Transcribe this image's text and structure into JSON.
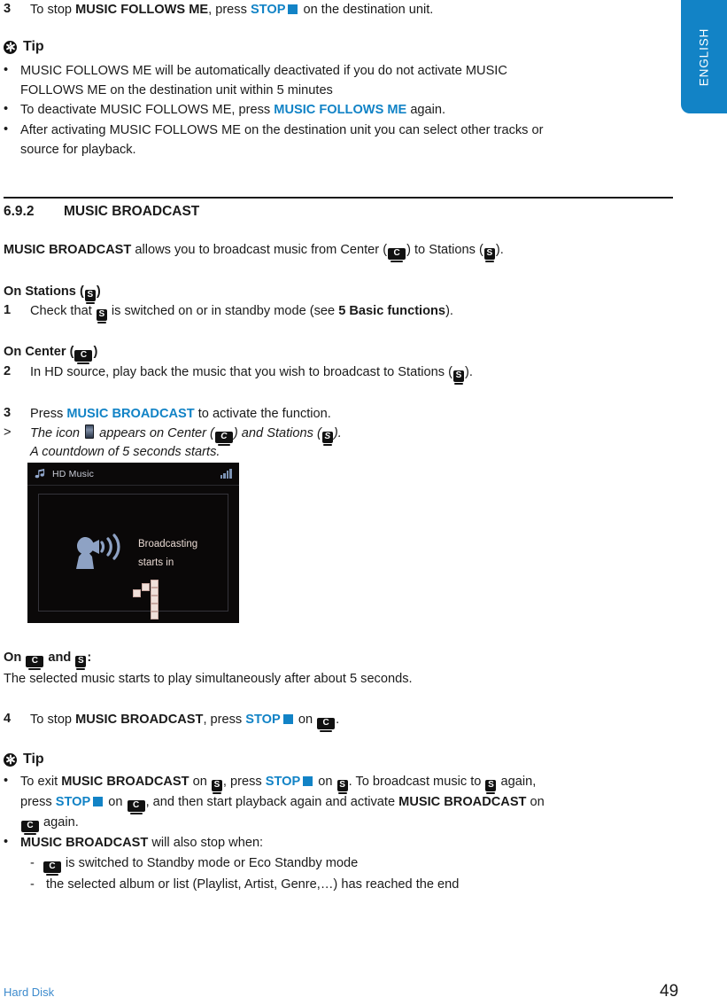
{
  "language_tab": {
    "label": "ENGLISH"
  },
  "footer": {
    "left": "Hard Disk",
    "page_number": "49"
  },
  "icons": {
    "center_letter": "C",
    "station_letter": "S",
    "tip_label": "Tip"
  },
  "step3": {
    "number": "3",
    "pre": "To stop ",
    "bold1": "MUSIC FOLLOWS ME",
    "mid": ", press ",
    "blue": "STOP",
    "post": " on the destination unit."
  },
  "tip1": {
    "label": "Tip",
    "bullets": [
      {
        "line1": "MUSIC FOLLOWS ME will be automatically deactivated if you do not activate MUSIC",
        "line2": "FOLLOWS ME on the destination unit within 5 minutes"
      },
      {
        "pre": "To deactivate MUSIC FOLLOWS ME, press ",
        "blue": "MUSIC FOLLOWS ME",
        "post": " again."
      },
      {
        "line1": "After activating MUSIC FOLLOWS ME on the destination unit you can select other tracks or",
        "line2": "source for playback."
      }
    ]
  },
  "section": {
    "number": "6.9.2",
    "title": "MUSIC BROADCAST"
  },
  "intro": {
    "bold": "MUSIC BROADCAST",
    "part1": " allows you to broadcast music from Center (",
    "part2": ") to Stations (",
    "part3": ")."
  },
  "on_stations": {
    "heading_pre": "On Stations (",
    "heading_post": ")",
    "step_number": "1",
    "text_pre": "Check that ",
    "text_mid": " is switched on or in standby mode (see ",
    "text_bold": "5 Basic functions",
    "text_post": ")."
  },
  "on_center": {
    "heading_pre": "On Center (",
    "heading_post": ")",
    "step2_number": "2",
    "step2_pre": "In HD source, play back the music that you wish to broadcast to Stations (",
    "step2_post": ").",
    "step3_number": "3",
    "step3_pre": "Press ",
    "step3_blue": "MUSIC BROADCAST",
    "step3_post": " to activate the function.",
    "result_marker": ">",
    "result_pre": "The icon ",
    "result_mid": " appears on Center (",
    "result_mid2": ") and Stations (",
    "result_post": ").",
    "result_line2": "A countdown of 5 seconds starts."
  },
  "device_screenshot": {
    "source_title": "HD Music",
    "message_line1": "Broadcasting",
    "message_line2": "starts in",
    "countdown_value": "1",
    "icons": {
      "source": "music-note-icon",
      "signal": "signal-strength-icon",
      "broadcast": "broadcast-speaker-icon"
    }
  },
  "on_both": {
    "heading_pre": "On ",
    "heading_mid": " and ",
    "heading_post": ":",
    "body": "The selected music starts to play simultaneously after about 5 seconds."
  },
  "step4": {
    "number": "4",
    "pre": "To stop ",
    "bold": "MUSIC BROADCAST",
    "mid": ", press ",
    "blue": "STOP",
    "on": " on ",
    "post": "."
  },
  "tip2": {
    "label": "Tip",
    "bullet1": {
      "a": "To exit ",
      "b_bold": "MUSIC BROADCAST",
      "c": " on ",
      "d": ", press ",
      "e_blue": "STOP",
      "f": " on ",
      "g": ". To broadcast music to ",
      "h": " again,",
      "line2_a": "press ",
      "line2_blue": "STOP",
      "line2_b": " on ",
      "line2_c": ", and then start playback again and activate ",
      "line2_bold": "MUSIC BROADCAST",
      "line2_d": " on",
      "line3": " again."
    },
    "bullet2": {
      "bold": "MUSIC BROADCAST",
      "text": " will also stop when:",
      "sub1_dash": "-",
      "sub1_text": " is switched to Standby mode or Eco Standby mode",
      "sub2_dash": "-",
      "sub2_text": "the selected album or list (Playlist, Artist, Genre,…) has reached the end"
    }
  },
  "colors": {
    "accent_blue": "#1283c6",
    "footer_blue": "#3d8bcd",
    "text": "#1a1a1a"
  }
}
